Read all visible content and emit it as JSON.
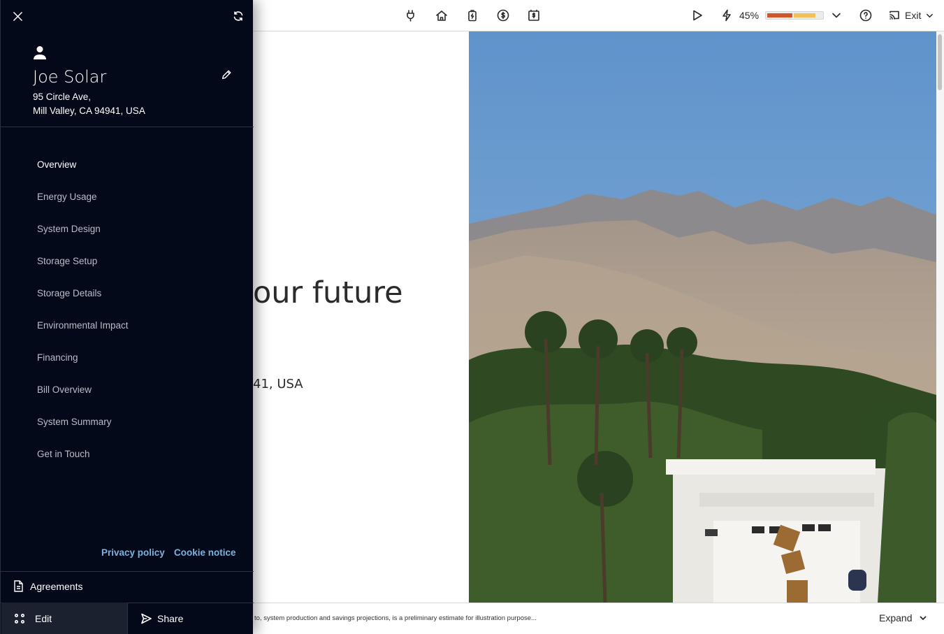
{
  "toolbar": {
    "icons": [
      "plug-icon",
      "home-icon",
      "battery-icon",
      "dollar-icon",
      "bill-icon",
      "play-icon",
      "lightning-icon",
      "help-icon",
      "cast-icon"
    ],
    "progress_percent_label": "45%",
    "progress_fraction": 0.45,
    "progress_colors": {
      "segment_a": "#d0562a",
      "segment_b": "#f2c057"
    },
    "exit_label": "Exit"
  },
  "hero": {
    "title_visible": "our future",
    "address_visible": "41, USA"
  },
  "footer": {
    "disclaimer": "to, system production and savings projections, is a preliminary estimate for illustration purpose...",
    "expand_label": "Expand"
  },
  "drawer": {
    "user": {
      "name": "Joe Solar",
      "address_line1": "95 Circle Ave,",
      "address_line2": "Mill Valley, CA 94941, USA"
    },
    "nav": [
      {
        "label": "Overview",
        "active": true
      },
      {
        "label": "Energy Usage"
      },
      {
        "label": "System Design"
      },
      {
        "label": "Storage Setup"
      },
      {
        "label": "Storage Details"
      },
      {
        "label": "Environmental Impact"
      },
      {
        "label": "Financing"
      },
      {
        "label": "Bill Overview"
      },
      {
        "label": "System Summary"
      },
      {
        "label": "Get in Touch"
      }
    ],
    "privacy_label": "Privacy policy",
    "cookie_label": "Cookie notice",
    "agreements_label": "Agreements",
    "edit_label": "Edit",
    "share_label": "Share"
  },
  "colors": {
    "drawer_bg": "#04091a",
    "link": "#7fb1dd",
    "sky": "#6f9ccc"
  }
}
